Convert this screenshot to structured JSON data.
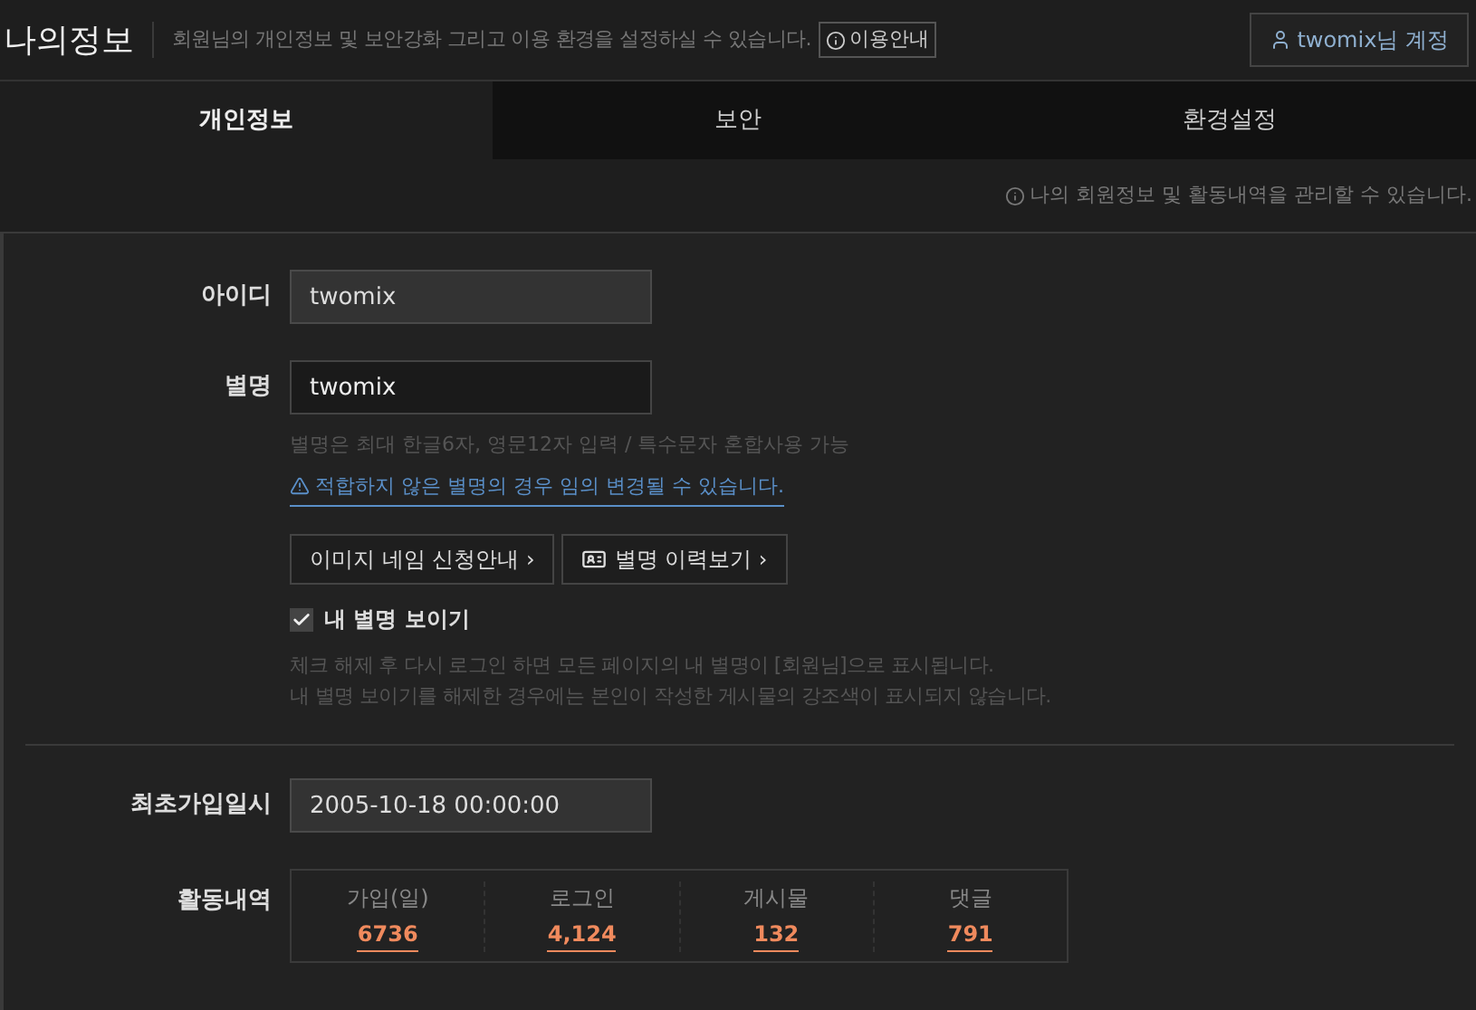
{
  "header": {
    "title": "나의정보",
    "description": "회원님의 개인정보 및 보안강화 그리고 이용 환경을 설정하실 수 있습니다.",
    "guide_button": "이용안내",
    "account_button": "twomix님 계정"
  },
  "tabs": [
    {
      "label": "개인정보",
      "selected": true
    },
    {
      "label": "보안",
      "selected": false
    },
    {
      "label": "환경설정",
      "selected": false
    }
  ],
  "notice": "나의 회원정보 및 활동내역을 관리할 수 있습니다.",
  "form": {
    "id": {
      "label": "아이디",
      "value": "twomix",
      "disabled": true
    },
    "nickname": {
      "label": "별명",
      "value": "twomix",
      "disabled": false,
      "hint": "별명은 최대 한글6자, 영문12자 입력 / 특수문자 혼합사용 가능",
      "warning": "적합하지 않은 별명의 경우 임의 변경될 수 있습니다.",
      "buttons": [
        {
          "label": "이미지 네임 신청안내 ›",
          "icon": false
        },
        {
          "label": "별명 이력보기 ›",
          "icon": true
        }
      ],
      "show_nickname": {
        "label": "내 별명 보이기",
        "checked": true
      },
      "notes": [
        "체크 해제 후 다시 로그인 하면 모든 페이지의 내 별명이 [회원님]으로 표시됩니다.",
        "내 별명 보이기를 해제한 경우에는 본인이 작성한 게시물의 강조색이 표시되지 않습니다."
      ]
    },
    "joined": {
      "label": "최초가입일시",
      "value": "2005-10-18 00:00:00",
      "disabled": true
    },
    "activity": {
      "label": "활동내역",
      "stats": [
        {
          "label": "가입(일)",
          "value": "6736"
        },
        {
          "label": "로그인",
          "value": "4,124"
        },
        {
          "label": "게시물",
          "value": "132"
        },
        {
          "label": "댓글",
          "value": "791"
        }
      ]
    }
  }
}
